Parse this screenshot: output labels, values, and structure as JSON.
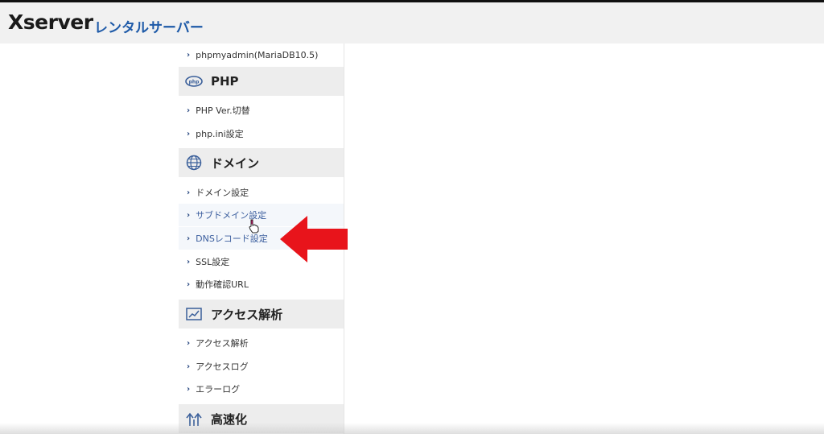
{
  "header": {
    "logo": "Xserver",
    "subtitle": "レンタルサーバー"
  },
  "sidebar": {
    "top_item": "phpmyadmin(MariaDB10.5)",
    "sections": [
      {
        "title": "PHP",
        "icon": "php-icon",
        "items": [
          "PHP Ver.切替",
          "php.ini設定"
        ]
      },
      {
        "title": "ドメイン",
        "icon": "globe-icon",
        "items": [
          "ドメイン設定",
          "サブドメイン設定",
          "DNSレコード設定",
          "SSL設定",
          "動作確認URL"
        ]
      },
      {
        "title": "アクセス解析",
        "icon": "chart-icon",
        "items": [
          "アクセス解析",
          "アクセスログ",
          "エラーログ"
        ]
      },
      {
        "title": "高速化",
        "icon": "speed-icon",
        "items": []
      }
    ]
  },
  "annotation": {
    "arrow_color": "#e8141b"
  }
}
